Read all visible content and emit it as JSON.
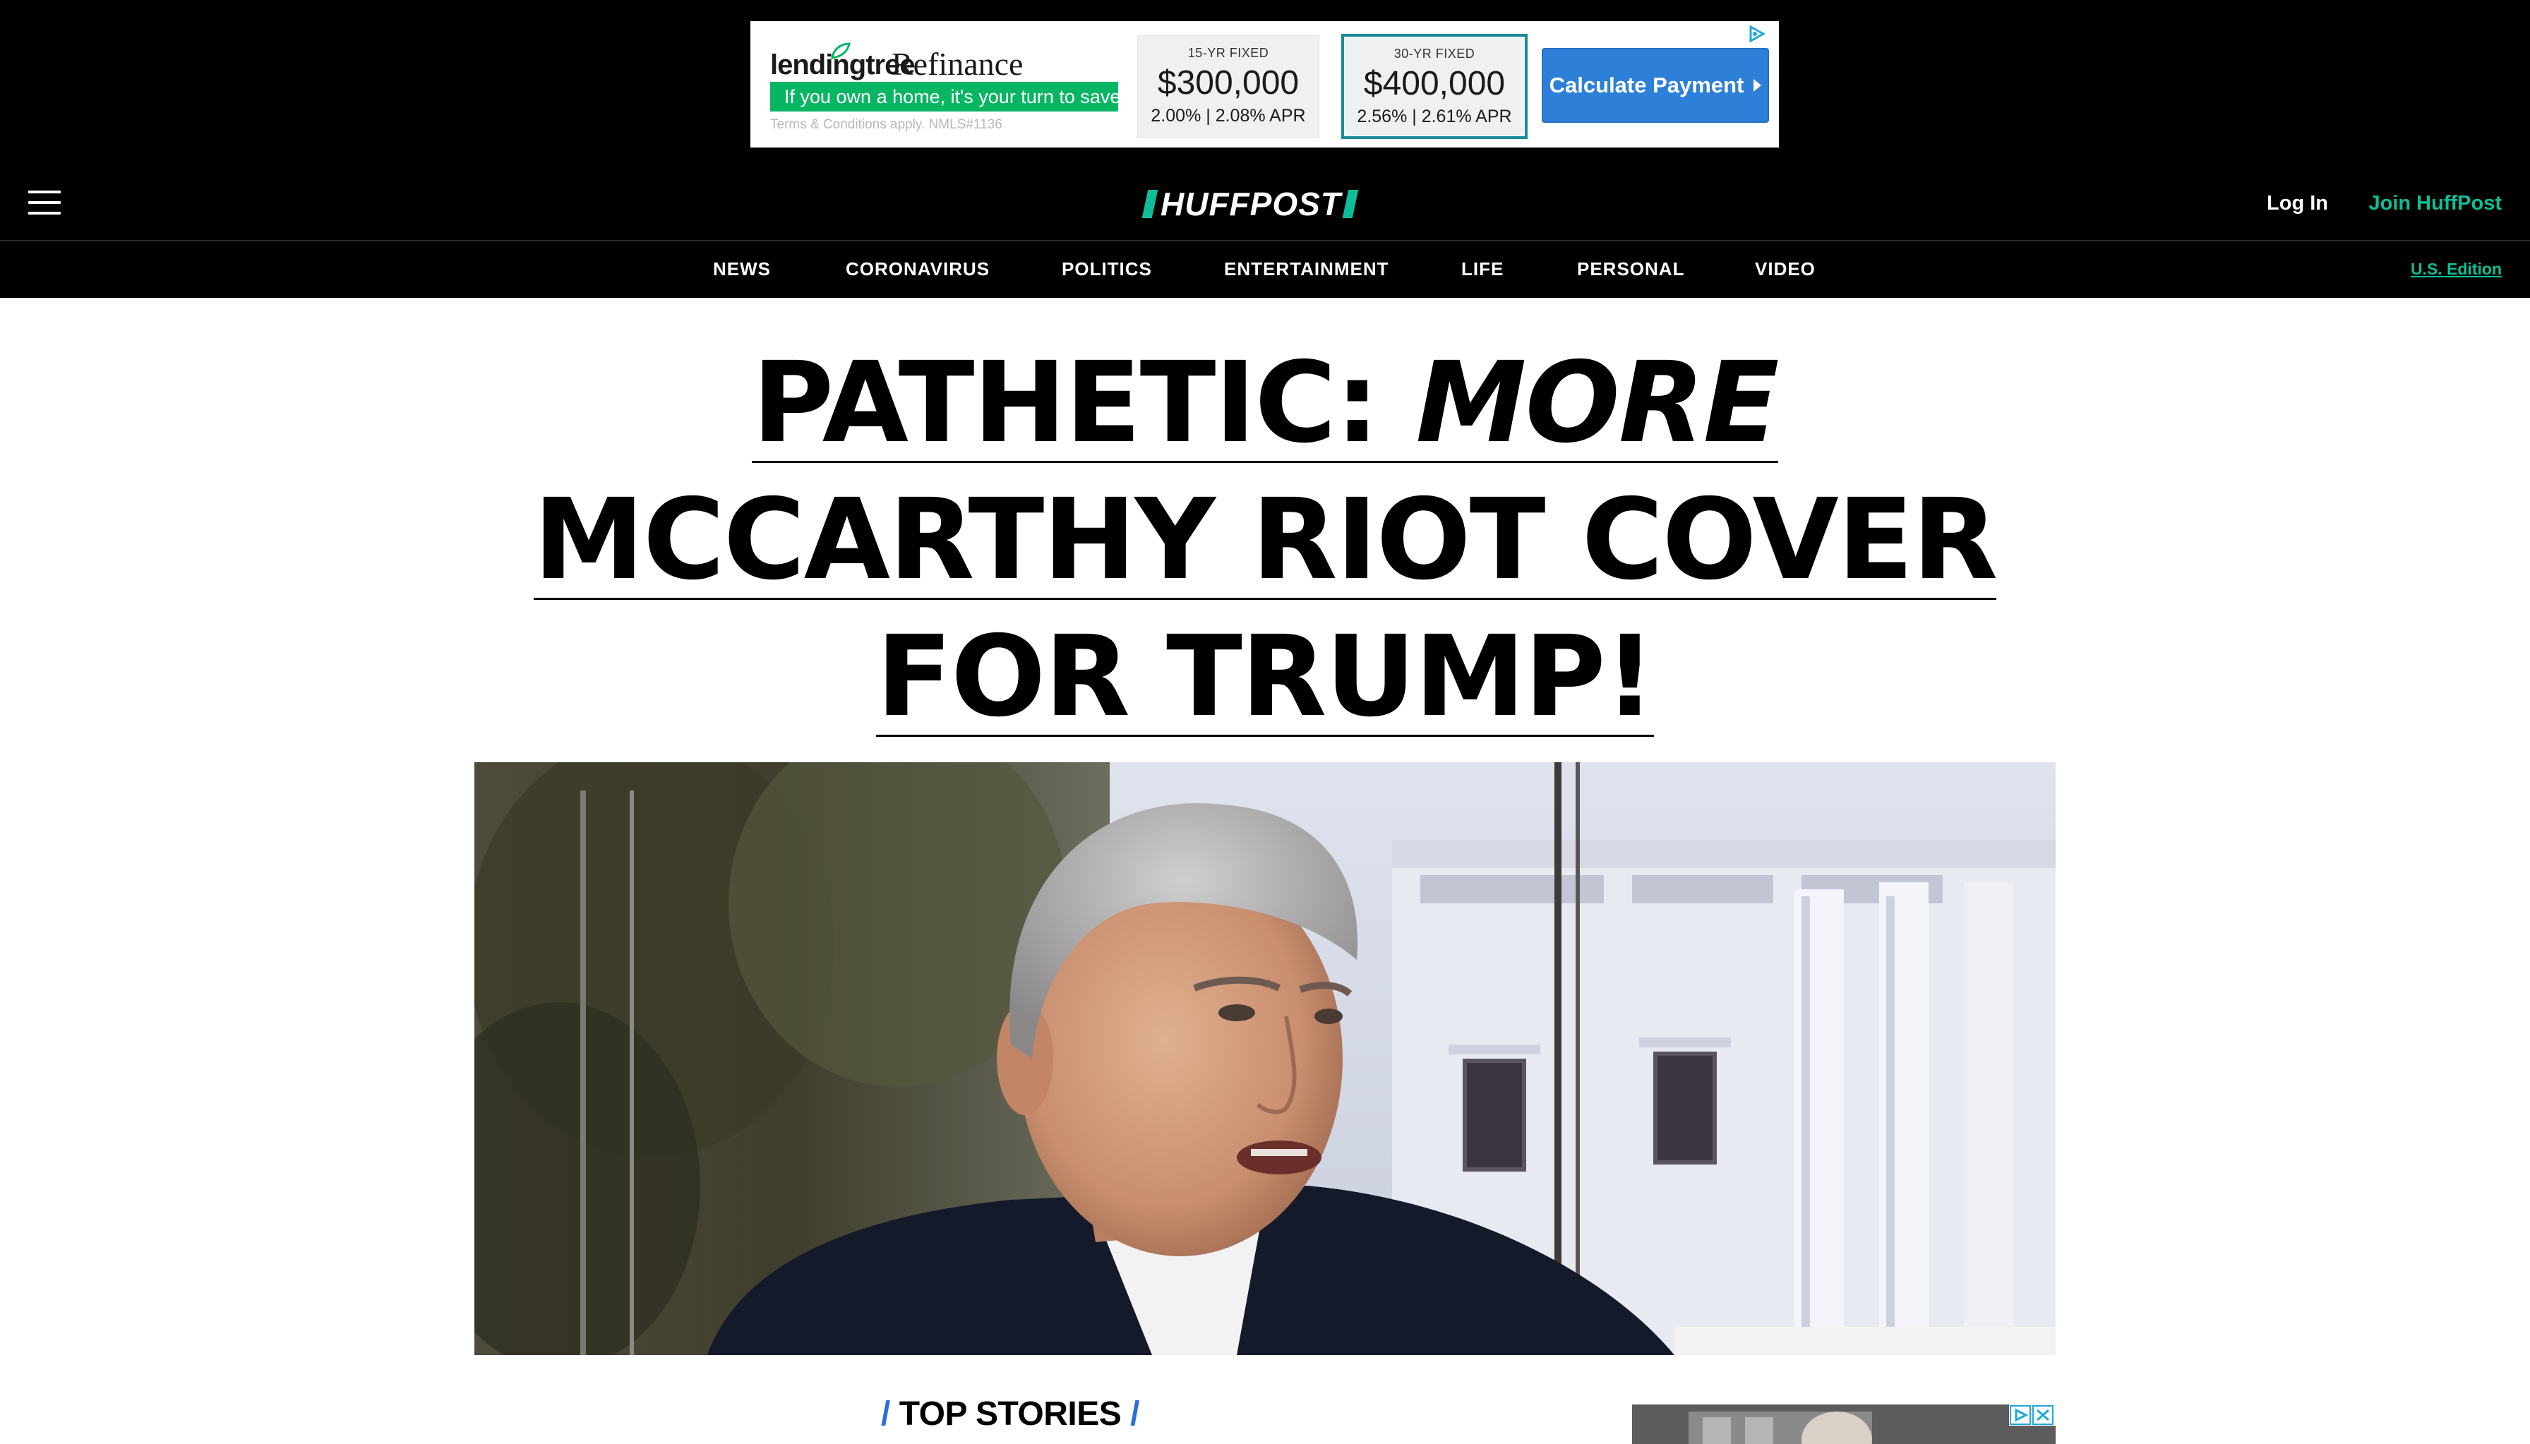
{
  "ad": {
    "brand": "lendingtree",
    "product": "Refinance",
    "tagline": "If you own a home, it's your turn to save",
    "terms": "Terms & Conditions apply. NMLS#1136",
    "rates": [
      {
        "label": "15-YR FIXED",
        "amount": "$300,000",
        "apr": "2.00% | 2.08% APR"
      },
      {
        "label": "30-YR FIXED",
        "amount": "$400,000",
        "apr": "2.56% | 2.61% APR"
      }
    ],
    "cta": "Calculate Payment",
    "colors": {
      "green": "#08b563",
      "cta_blue": "#2d7fd8",
      "card_border": "#1c8a9c"
    }
  },
  "header": {
    "logo": "HUFFPOST",
    "login": "Log In",
    "join": "Join HuffPost",
    "colors": {
      "brand_green": "#0dbe98"
    }
  },
  "nav": {
    "items": [
      "NEWS",
      "CORONAVIRUS",
      "POLITICS",
      "ENTERTAINMENT",
      "LIFE",
      "PERSONAL",
      "VIDEO"
    ],
    "edition": "U.S. Edition"
  },
  "headline": {
    "prefix": "PATHETIC: ",
    "emphasis": "MORE",
    "line2": "MCCARTHY RIOT COVER",
    "line3": "FOR TRUMP!"
  },
  "hero": {
    "icon": "hero-photo"
  },
  "top_stories": {
    "label": "TOP STORIES"
  }
}
